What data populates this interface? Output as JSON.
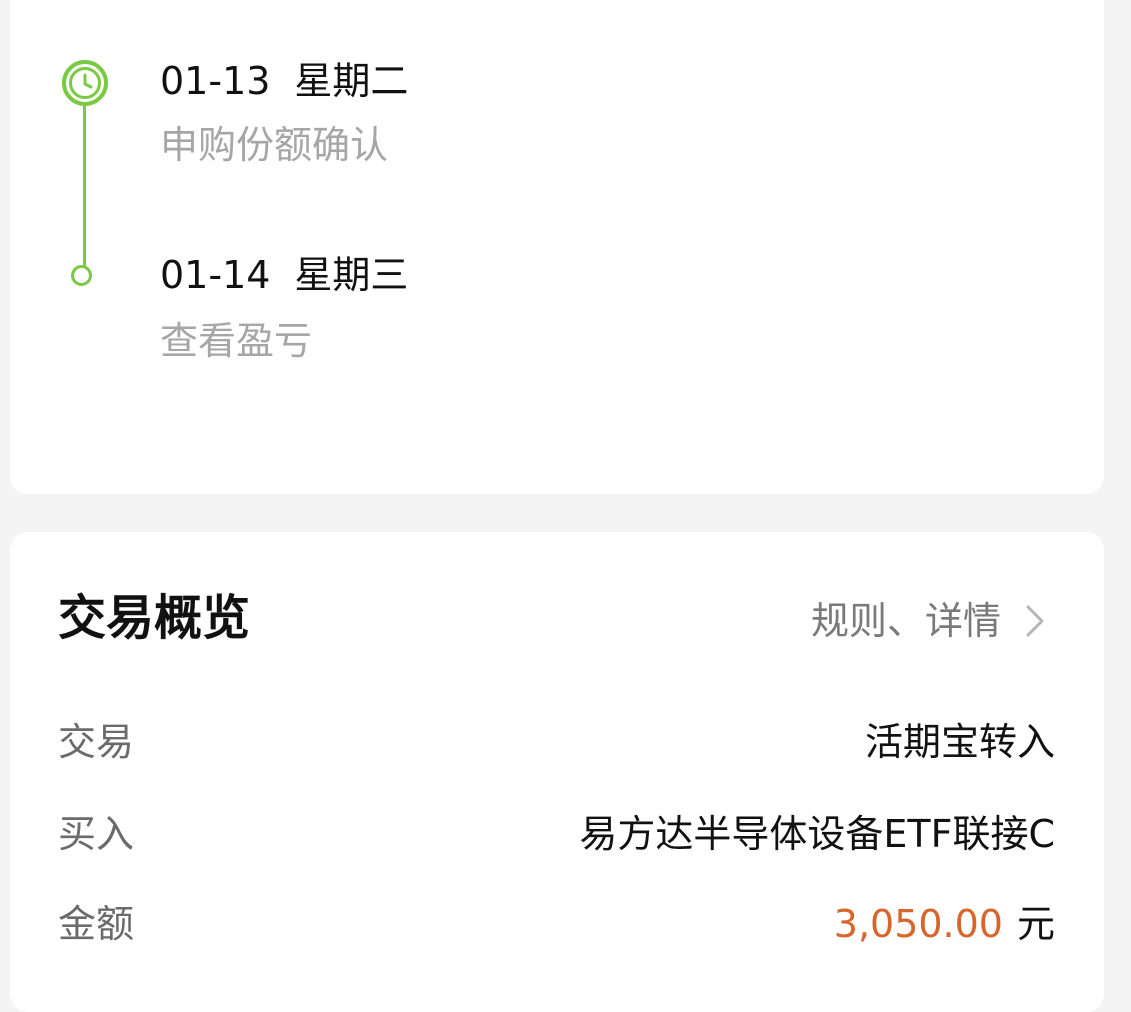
{
  "timeline": {
    "steps": [
      {
        "date": "01-13",
        "weekday": "星期二",
        "desc": "申购份额确认",
        "icon": "clock-icon"
      },
      {
        "date": "01-14",
        "weekday": "星期三",
        "desc": "查看盈亏",
        "icon": "circle-dot-icon"
      }
    ]
  },
  "overview": {
    "title": "交易概览",
    "link_label": "规则、详情",
    "rows": [
      {
        "label": "交易",
        "value": "活期宝转入"
      },
      {
        "label": "买入",
        "value": "易方达半导体设备ETF联接C"
      },
      {
        "label": "金额",
        "value": "3,050.00",
        "unit": "元"
      }
    ]
  },
  "colors": {
    "accent_green": "#7ac943",
    "amount_orange": "#d8652a",
    "muted_text": "#a6a6a6"
  }
}
